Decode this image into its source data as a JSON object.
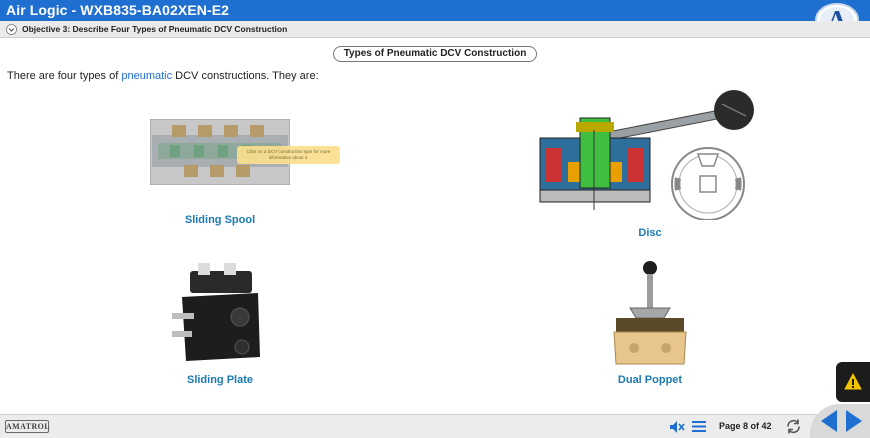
{
  "header": {
    "title": "Air Logic - WXB835-BA02XEN-E2"
  },
  "objective": {
    "label": "Objective 3: Describe Four Types of Pneumatic DCV Construction"
  },
  "content": {
    "section_title": "Types of Pneumatic DCV Construction",
    "intro_before": "There are four types of ",
    "intro_keyword": "pneumatic",
    "intro_after": " DCV constructions. They are:",
    "tooltip": "Click on a DCV construction type for more information about it.",
    "items": [
      {
        "label": "Sliding Spool"
      },
      {
        "label": "Disc"
      },
      {
        "label": "Sliding Plate"
      },
      {
        "label": "Dual Poppet"
      }
    ]
  },
  "footer": {
    "brand": "AMATROL",
    "page_label": "Page 8 of 42"
  },
  "colors": {
    "title_bar": "#1f6fd1",
    "caption": "#1b7ab5",
    "nav_arrow": "#1f6fd1",
    "warning": "#f5c400"
  },
  "icons": [
    "logo-a-icon",
    "chevron-down-icon",
    "warning-icon",
    "mute-icon",
    "menu-icon",
    "refresh-icon",
    "prev-arrow-icon",
    "next-arrow-icon"
  ]
}
